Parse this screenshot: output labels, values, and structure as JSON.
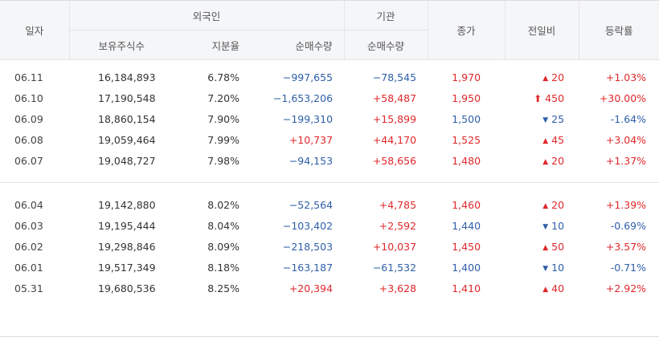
{
  "headers": {
    "date": "일자",
    "foreign": "외국인",
    "institution": "기관",
    "holding": "보유주식수",
    "ratio": "지분율",
    "foreign_net": "순매수량",
    "inst_net": "순매수량",
    "close": "종가",
    "change": "전일비",
    "rate": "등락률"
  },
  "group1": [
    {
      "date": "06.11",
      "holding": "16,184,893",
      "ratio": "6.78%",
      "foreign_net": "−997,655",
      "fdir": "down",
      "inst_net": "−78,545",
      "idir": "down",
      "close": "1,970",
      "cdir": "up",
      "arrow": "▲",
      "change": "20",
      "chdir": "up",
      "rate": "+1.03%",
      "rdir": "up"
    },
    {
      "date": "06.10",
      "holding": "17,190,548",
      "ratio": "7.20%",
      "foreign_net": "−1,653,206",
      "fdir": "down",
      "inst_net": "+58,487",
      "idir": "up",
      "close": "1,950",
      "cdir": "up",
      "arrow": "⬆",
      "change": "450",
      "chdir": "up",
      "rate": "+30.00%",
      "rdir": "up"
    },
    {
      "date": "06.09",
      "holding": "18,860,154",
      "ratio": "7.90%",
      "foreign_net": "−199,310",
      "fdir": "down",
      "inst_net": "+15,899",
      "idir": "up",
      "close": "1,500",
      "cdir": "down",
      "arrow": "▼",
      "change": "25",
      "chdir": "down",
      "rate": "-1.64%",
      "rdir": "down"
    },
    {
      "date": "06.08",
      "holding": "19,059,464",
      "ratio": "7.99%",
      "foreign_net": "+10,737",
      "fdir": "up",
      "inst_net": "+44,170",
      "idir": "up",
      "close": "1,525",
      "cdir": "up",
      "arrow": "▲",
      "change": "45",
      "chdir": "up",
      "rate": "+3.04%",
      "rdir": "up"
    },
    {
      "date": "06.07",
      "holding": "19,048,727",
      "ratio": "7.98%",
      "foreign_net": "−94,153",
      "fdir": "down",
      "inst_net": "+58,656",
      "idir": "up",
      "close": "1,480",
      "cdir": "up",
      "arrow": "▲",
      "change": "20",
      "chdir": "up",
      "rate": "+1.37%",
      "rdir": "up"
    }
  ],
  "group2": [
    {
      "date": "06.04",
      "holding": "19,142,880",
      "ratio": "8.02%",
      "foreign_net": "−52,564",
      "fdir": "down",
      "inst_net": "+4,785",
      "idir": "up",
      "close": "1,460",
      "cdir": "up",
      "arrow": "▲",
      "change": "20",
      "chdir": "up",
      "rate": "+1.39%",
      "rdir": "up"
    },
    {
      "date": "06.03",
      "holding": "19,195,444",
      "ratio": "8.04%",
      "foreign_net": "−103,402",
      "fdir": "down",
      "inst_net": "+2,592",
      "idir": "up",
      "close": "1,440",
      "cdir": "down",
      "arrow": "▼",
      "change": "10",
      "chdir": "down",
      "rate": "-0.69%",
      "rdir": "down"
    },
    {
      "date": "06.02",
      "holding": "19,298,846",
      "ratio": "8.09%",
      "foreign_net": "−218,503",
      "fdir": "down",
      "inst_net": "+10,037",
      "idir": "up",
      "close": "1,450",
      "cdir": "up",
      "arrow": "▲",
      "change": "50",
      "chdir": "up",
      "rate": "+3.57%",
      "rdir": "up"
    },
    {
      "date": "06.01",
      "holding": "19,517,349",
      "ratio": "8.18%",
      "foreign_net": "−163,187",
      "fdir": "down",
      "inst_net": "−61,532",
      "idir": "down",
      "close": "1,400",
      "cdir": "down",
      "arrow": "▼",
      "change": "10",
      "chdir": "down",
      "rate": "-0.71%",
      "rdir": "down"
    },
    {
      "date": "05.31",
      "holding": "19,680,536",
      "ratio": "8.25%",
      "foreign_net": "+20,394",
      "fdir": "up",
      "inst_net": "+3,628",
      "idir": "up",
      "close": "1,410",
      "cdir": "up",
      "arrow": "▲",
      "change": "40",
      "chdir": "up",
      "rate": "+2.92%",
      "rdir": "up"
    }
  ]
}
